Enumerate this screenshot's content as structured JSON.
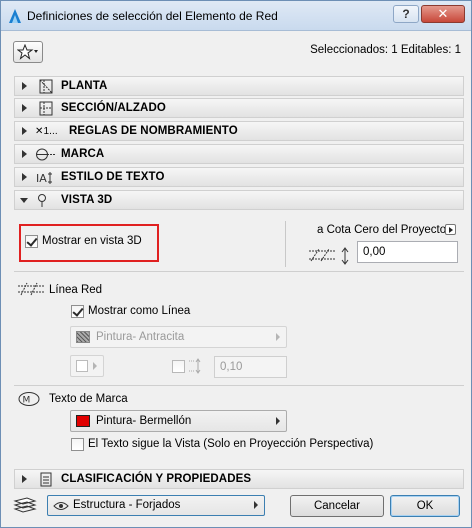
{
  "window": {
    "title": "Definiciones de selección del Elemento de Red",
    "help_label": "?",
    "close_label": "✕"
  },
  "header": {
    "selection_info": "Seleccionados: 1 Editables: 1",
    "favorites_icon": "star-icon"
  },
  "sections": [
    {
      "label": "PLANTA",
      "icon": "floor-plan-icon",
      "expanded": false
    },
    {
      "label": "SECCIÓN/ALZADO",
      "icon": "section-icon",
      "expanded": false
    },
    {
      "label": "REGLAS DE NOMBRAMIENTO",
      "icon": "naming-icon",
      "prefix": "✕1...",
      "expanded": false
    },
    {
      "label": "MARCA",
      "icon": "marker-icon",
      "expanded": false
    },
    {
      "label": "ESTILO DE TEXTO",
      "icon": "text-style-icon",
      "expanded": false
    },
    {
      "label": "VISTA 3D",
      "icon": "view-3d-icon",
      "expanded": true
    }
  ],
  "vista3d": {
    "show_in_3d_label": "Mostrar en vista 3D",
    "show_in_3d_checked": true,
    "elevation_label": "a Cota Cero del Proyecto",
    "elevation_value": "0,00",
    "grid_line_heading": "Línea Red",
    "show_as_line_label": "Mostrar como Línea",
    "show_as_line_checked": true,
    "line_paint": "Pintura- Antracita",
    "line_paint_color": "#5a5a5a",
    "line_thickness": "0,10",
    "marker_text_heading": "Texto de Marca",
    "marker_paint": "Pintura- Bermellón",
    "marker_paint_color": "#e00000",
    "text_follows_view_label": "El Texto sigue la Vista (Solo en Proyección Perspectiva)",
    "text_follows_view_checked": false
  },
  "classification": {
    "label": "CLASIFICACIÓN Y PROPIEDADES",
    "expanded": false
  },
  "footer": {
    "layer": "Estructura - Forjados",
    "cancel_label": "Cancelar",
    "ok_label": "OK"
  }
}
